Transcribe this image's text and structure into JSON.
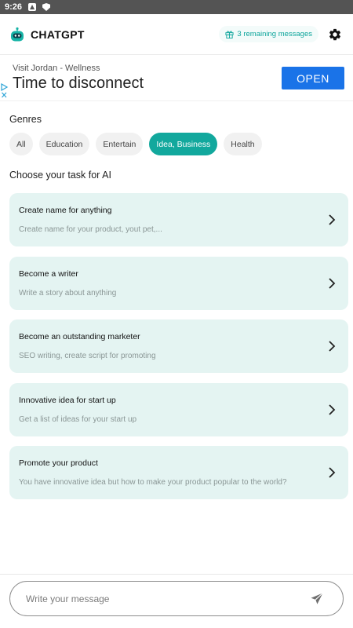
{
  "status_bar": {
    "time": "9:26"
  },
  "header": {
    "brand": "CHATGPT",
    "remaining": "3 remaining messages"
  },
  "ad": {
    "subtitle": "Visit Jordan - Wellness",
    "title": "Time to disconnect",
    "cta": "OPEN"
  },
  "genres": {
    "title": "Genres",
    "items": [
      "All",
      "Education",
      "Entertain",
      "Idea, Business",
      "Health"
    ],
    "active": "Idea, Business"
  },
  "tasks": {
    "title": "Choose your task for AI",
    "items": [
      {
        "title": "Create name for anything",
        "desc": "Create name for your product, yout pet,..."
      },
      {
        "title": "Become a writer",
        "desc": "Write a story about anything"
      },
      {
        "title": "Become an outstanding marketer",
        "desc": "SEO writing, create script for promoting"
      },
      {
        "title": "Innovative idea for start up",
        "desc": "Get a list of ideas for your start up"
      },
      {
        "title": "Promote your product",
        "desc": "You have innovative idea but how to make your product popular to the world?"
      }
    ]
  },
  "composer": {
    "placeholder": "Write your message"
  },
  "colors": {
    "accent": "#12a89d",
    "card_bg": "#e4f4f2",
    "ad_button": "#1a73e8"
  }
}
